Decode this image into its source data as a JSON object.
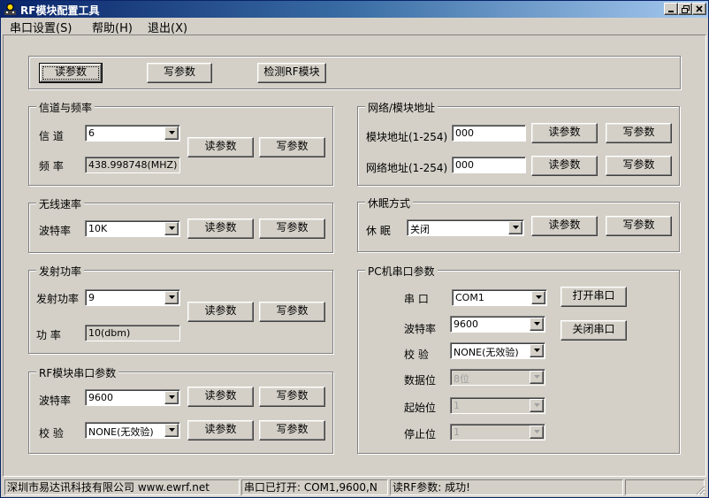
{
  "window": {
    "title": "RF模块配置工具"
  },
  "menu": [
    "串口设置(S)",
    "帮助(H)",
    "退出(X)"
  ],
  "top_buttons": {
    "read": "读参数",
    "write": "写参数",
    "detect": "检测RF模块"
  },
  "channel": {
    "title": "信道与频率",
    "channel_label": "信  道",
    "channel_value": "6",
    "freq_label": "频  率",
    "freq_value": "438.998748(MHZ)",
    "read": "读参数",
    "write": "写参数"
  },
  "wireless": {
    "title": "无线速率",
    "baud_label": "波特率",
    "baud_value": "10K",
    "read": "读参数",
    "write": "写参数"
  },
  "power": {
    "title": "发射功率",
    "power_label": "发射功率",
    "power_value": "9",
    "dbm_label": "功   率",
    "dbm_value": "10(dbm)",
    "read": "读参数",
    "write": "写参数"
  },
  "rf_serial": {
    "title": "RF模块串口参数",
    "baud_label": "波特率",
    "baud_value": "9600",
    "parity_label": "校  验",
    "parity_value": "NONE(无效验)",
    "read": "读参数",
    "write": "写参数"
  },
  "address": {
    "title": "网络/模块地址",
    "module_label": "模块地址(1-254)",
    "module_value": "000",
    "network_label": "网络地址(1-254)",
    "network_value": "000",
    "read": "读参数",
    "write": "写参数"
  },
  "sleep": {
    "title": "休眠方式",
    "sleep_label": "休  眠",
    "sleep_value": "关闭",
    "read": "读参数",
    "write": "写参数"
  },
  "pc_serial": {
    "title": "PC机串口参数",
    "port_label": "串  口",
    "port_value": "COM1",
    "baud_label": "波特率",
    "baud_value": "9600",
    "parity_label": "校  验",
    "parity_value": "NONE(无效验)",
    "data_label": "数据位",
    "data_value": "8位",
    "start_label": "起始位",
    "start_value": "1",
    "stop_label": "停止位",
    "stop_value": "1",
    "open": "打开串口",
    "close": "关闭串口"
  },
  "status": {
    "company": "深圳市易达讯科技有限公司 www.ewrf.net",
    "port": "串口已打开: COM1,9600,N",
    "result": "读RF参数: 成功!"
  }
}
